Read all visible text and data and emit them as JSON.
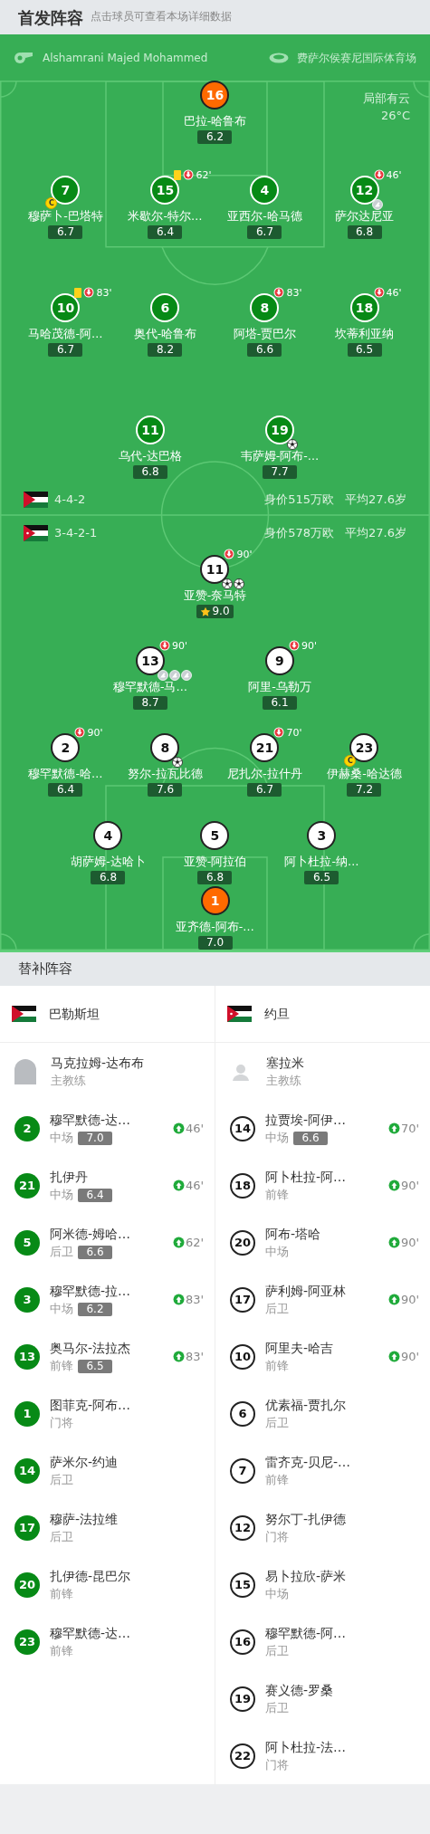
{
  "lineup": {
    "title": "首发阵容",
    "hint": "点击球员可查看本场详细数据",
    "referee": "Alshamrani Majed Mohammed",
    "venue": "费萨尔侯赛尼国际体育场",
    "weather": "局部有云",
    "temperature": "26°C",
    "teams": [
      {
        "kind": "home",
        "formation": "4-4-2",
        "value": "身价515万欧",
        "avg_age": "平均27.6岁",
        "lines": [
          {
            "players": [
              {
                "number": "16",
                "name": "巴拉-哈鲁布",
                "rating": "6.2",
                "kind": "goalkeeper"
              }
            ]
          },
          {
            "players": [
              {
                "number": "7",
                "name": "穆萨卜-巴塔特",
                "rating": "6.7",
                "kind": "outfield",
                "captain_badge": "C"
              },
              {
                "number": "15",
                "name": "米歇尔-特尔…",
                "rating": "6.4",
                "kind": "outfield",
                "yellow_card": true,
                "sub_off": "62'"
              },
              {
                "number": "4",
                "name": "亚西尔-哈马德",
                "rating": "6.7",
                "kind": "outfield"
              },
              {
                "number": "12",
                "name": "萨尔达尼亚",
                "rating": "6.8",
                "kind": "outfield",
                "sub_off": "46'",
                "badges": [
                  {
                    "kind": "assist"
                  }
                ]
              }
            ]
          },
          {
            "players": [
              {
                "number": "10",
                "name": "马哈茂德-阿…",
                "rating": "6.7",
                "kind": "outfield",
                "yellow_card": true,
                "sub_off": "83'"
              },
              {
                "number": "6",
                "name": "奥代-哈鲁布",
                "rating": "8.2",
                "kind": "outfield"
              },
              {
                "number": "8",
                "name": "阿塔-贾巴尔",
                "rating": "6.6",
                "kind": "outfield",
                "sub_off": "83'"
              },
              {
                "number": "18",
                "name": "坎蒂利亚纳",
                "rating": "6.5",
                "kind": "outfield",
                "sub_off": "46'"
              }
            ]
          },
          {
            "players": [
              {
                "number": "11",
                "name": "乌代-达巴格",
                "rating": "6.8",
                "kind": "outfield"
              },
              {
                "number": "19",
                "name": "韦萨姆-阿布-…",
                "rating": "7.7",
                "kind": "outfield",
                "badges": [
                  {
                    "kind": "goal"
                  }
                ]
              }
            ]
          }
        ]
      },
      {
        "kind": "away",
        "formation": "3-4-2-1",
        "value": "身价578万欧",
        "avg_age": "平均27.6岁",
        "lines": [
          {
            "players": [
              {
                "number": "11",
                "name": "亚赞-奈马特",
                "rating": "9.0",
                "kind": "outfield",
                "sub_off": "90'",
                "best": true,
                "badges": [
                  {
                    "kind": "goal"
                  },
                  {
                    "kind": "goal"
                  }
                ]
              }
            ]
          },
          {
            "players": [
              {
                "number": "13",
                "name": "穆罕默德-马…",
                "rating": "8.7",
                "kind": "outfield",
                "sub_off": "90'",
                "badges": [
                  {
                    "kind": "assist"
                  },
                  {
                    "kind": "assist"
                  },
                  {
                    "kind": "assist"
                  }
                ]
              },
              {
                "number": "9",
                "name": "阿里-乌勒万",
                "rating": "6.1",
                "kind": "outfield",
                "sub_off": "90'"
              }
            ]
          },
          {
            "players": [
              {
                "number": "2",
                "name": "穆罕默德-哈…",
                "rating": "6.4",
                "kind": "outfield",
                "sub_off": "90'"
              },
              {
                "number": "8",
                "name": "努尔-拉瓦比德",
                "rating": "7.6",
                "kind": "outfield",
                "badges": [
                  {
                    "kind": "goal"
                  }
                ]
              },
              {
                "number": "21",
                "name": "尼扎尔-拉什丹",
                "rating": "6.7",
                "kind": "outfield",
                "sub_off": "70'"
              },
              {
                "number": "23",
                "name": "伊赫桑-哈达德",
                "rating": "7.2",
                "kind": "outfield",
                "captain_badge": "C"
              }
            ]
          },
          {
            "players": [
              {
                "number": "4",
                "name": "胡萨姆-达哈卜",
                "rating": "6.8",
                "kind": "outfield"
              },
              {
                "number": "5",
                "name": "亚赞-阿拉伯",
                "rating": "6.8",
                "kind": "outfield"
              },
              {
                "number": "3",
                "name": "阿卜杜拉-纳…",
                "rating": "6.5",
                "kind": "outfield"
              }
            ]
          },
          {
            "players": [
              {
                "number": "1",
                "name": "亚齐德-阿布-…",
                "rating": "7.0",
                "kind": "goalkeeper"
              }
            ]
          }
        ]
      }
    ]
  },
  "substitutes": {
    "title": "替补阵容",
    "teams": [
      {
        "name": "巴勒斯坦",
        "kind": "home",
        "coach": {
          "name": "马克拉姆-达布布",
          "role": "主教练",
          "has_photo": true
        },
        "players": [
          {
            "number": "2",
            "name": "穆罕默德-达…",
            "position": "中场",
            "rating": "7.0",
            "sub_on": "46'"
          },
          {
            "number": "21",
            "name": "扎伊丹",
            "position": "中场",
            "rating": "6.4",
            "sub_on": "46'"
          },
          {
            "number": "5",
            "name": "阿米德-姆哈…",
            "position": "后卫",
            "rating": "6.6",
            "sub_on": "62'"
          },
          {
            "number": "3",
            "name": "穆罕默德-拉…",
            "position": "中场",
            "rating": "6.2",
            "sub_on": "83'"
          },
          {
            "number": "13",
            "name": "奥马尔-法拉杰",
            "position": "前锋",
            "rating": "6.5",
            "sub_on": "83'"
          },
          {
            "number": "1",
            "name": "图菲克-阿布…",
            "position": "门将"
          },
          {
            "number": "14",
            "name": "萨米尔-约迪",
            "position": "后卫"
          },
          {
            "number": "17",
            "name": "穆萨-法拉维",
            "position": "后卫"
          },
          {
            "number": "20",
            "name": "扎伊德-昆巴尔",
            "position": "前锋"
          },
          {
            "number": "23",
            "name": "穆罕默德-达…",
            "position": "前锋"
          }
        ]
      },
      {
        "name": "约旦",
        "kind": "away",
        "coach": {
          "name": "塞拉米",
          "role": "主教练",
          "has_photo": false
        },
        "players": [
          {
            "number": "14",
            "name": "拉贾埃-阿伊…",
            "position": "中场",
            "rating": "6.6",
            "sub_on": "70'"
          },
          {
            "number": "18",
            "name": "阿卜杜拉-阿…",
            "position": "前锋",
            "sub_on": "90'"
          },
          {
            "number": "20",
            "name": "阿布-塔哈",
            "position": "中场",
            "sub_on": "90'"
          },
          {
            "number": "17",
            "name": "萨利姆-阿亚林",
            "position": "后卫",
            "sub_on": "90'"
          },
          {
            "number": "10",
            "name": "阿里夫-哈吉",
            "position": "前锋",
            "sub_on": "90'"
          },
          {
            "number": "6",
            "name": "优素福-贾扎尔",
            "position": "后卫"
          },
          {
            "number": "7",
            "name": "雷齐克-贝尼-…",
            "position": "前锋"
          },
          {
            "number": "12",
            "name": "努尔丁-扎伊德",
            "position": "门将"
          },
          {
            "number": "15",
            "name": "易卜拉欣-萨米",
            "position": "中场"
          },
          {
            "number": "16",
            "name": "穆罕默德-阿…",
            "position": "后卫"
          },
          {
            "number": "19",
            "name": "赛义德-罗桑",
            "position": "后卫"
          },
          {
            "number": "22",
            "name": "阿卜杜拉-法…",
            "position": "门将"
          }
        ]
      }
    ]
  }
}
